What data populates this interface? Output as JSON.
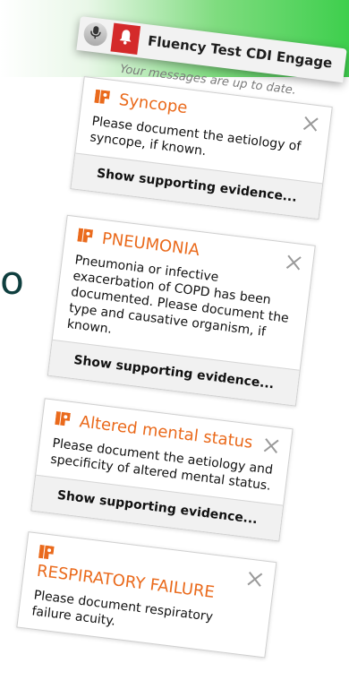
{
  "background_fragment": "o",
  "header": {
    "title": "Fluency Test CDI Engage"
  },
  "status_message": "Your messages are up to date.",
  "alerts": [
    {
      "title": "Syncope",
      "body": "Please document the aetiology of syncope, if known.",
      "evidence_label": "Show supporting evidence..."
    },
    {
      "title": "PNEUMONIA",
      "body": "Pneumonia or infective exacerbation of COPD has been documented.  Please document the type and causative organism, if known.",
      "evidence_label": "Show supporting evidence..."
    },
    {
      "title": "Altered mental status",
      "body": "Please document the aetiology and specificity of altered mental status.",
      "evidence_label": "Show supporting evidence..."
    },
    {
      "title": "RESPIRATORY FAILURE",
      "body": "Please document respiratory failure acuity.",
      "evidence_label": ""
    }
  ],
  "icons": {
    "mic": "microphone-icon",
    "bell": "bell-icon",
    "flag": "alert-flag-icon",
    "close": "close-icon"
  },
  "colors": {
    "accent_orange": "#ea6a1c",
    "bell_red": "#d42a2a",
    "green": "#3ecf4d"
  }
}
